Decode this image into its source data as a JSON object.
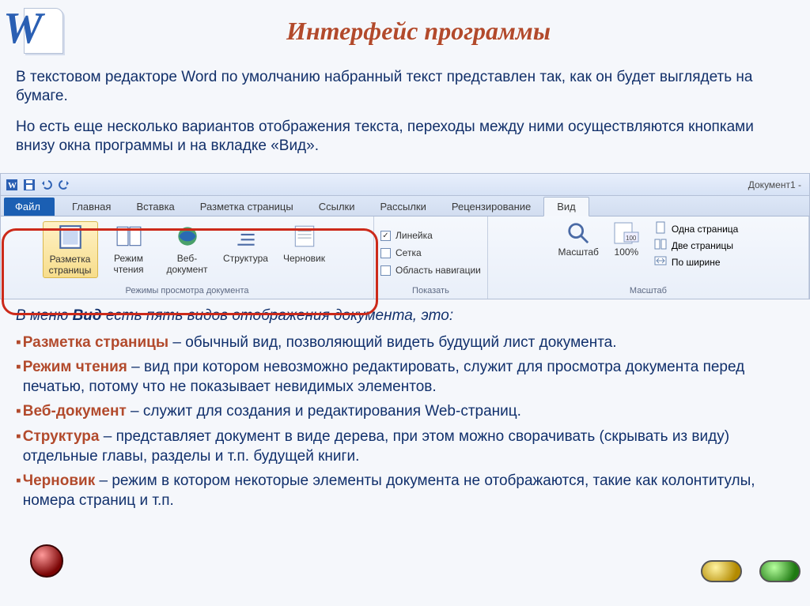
{
  "header": {
    "title": "Интерфейс программы"
  },
  "intro": {
    "p1": "В текстовом редакторе Word по умолчанию набранный текст представлен так, как он будет выглядеть на бумаге.",
    "p2": "Но есть еще несколько вариантов отображения текста, переходы между ними осуществляются кнопками внизу окна программы и на вкладке «Вид»."
  },
  "ribbon": {
    "doc_title": "Документ1 -",
    "file_tab": "Файл",
    "tabs": [
      "Главная",
      "Вставка",
      "Разметка страницы",
      "Ссылки",
      "Рассылки",
      "Рецензирование",
      "Вид"
    ],
    "active_tab_index": 6,
    "view_modes_group": {
      "caption": "Режимы просмотра документа",
      "buttons": [
        "Разметка страницы",
        "Режим чтения",
        "Веб-документ",
        "Структура",
        "Черновик"
      ]
    },
    "show_group": {
      "caption": "Показать",
      "items": [
        {
          "label": "Линейка",
          "checked": true
        },
        {
          "label": "Сетка",
          "checked": false
        },
        {
          "label": "Область навигации",
          "checked": false
        }
      ]
    },
    "zoom_group": {
      "caption": "Масштаб",
      "zoom_label": "Масштаб",
      "zoom_value": "100%",
      "right": [
        "Одна страница",
        "Две страницы",
        "По ширине"
      ]
    }
  },
  "body": {
    "lead_prefix": "В меню ",
    "lead_bold": "Вид",
    "lead_suffix": " есть пять видов отображения документа, это:",
    "items": [
      {
        "term": "Разметка страницы",
        "desc": " – обычный вид, позволяющий видеть будущий лист документа."
      },
      {
        "term": "Режим чтения",
        "desc": " – вид при котором невозможно редактировать, служит для просмотра документа перед печатью, потому что не показывает невидимых элементов."
      },
      {
        "term": "Веб-документ",
        "desc": " – служит для создания и редактирования Web-страниц."
      },
      {
        "term": "Структура",
        "desc": " – представляет документ в виде дерева, при этом можно сворачивать (скрывать из виду) отдельные главы, разделы и т.п. будущей книги."
      },
      {
        "term": "Черновик",
        "desc": " – режим в котором некоторые элементы документа не отображаются, такие как колонтитулы, номера страниц и т.п."
      }
    ]
  }
}
